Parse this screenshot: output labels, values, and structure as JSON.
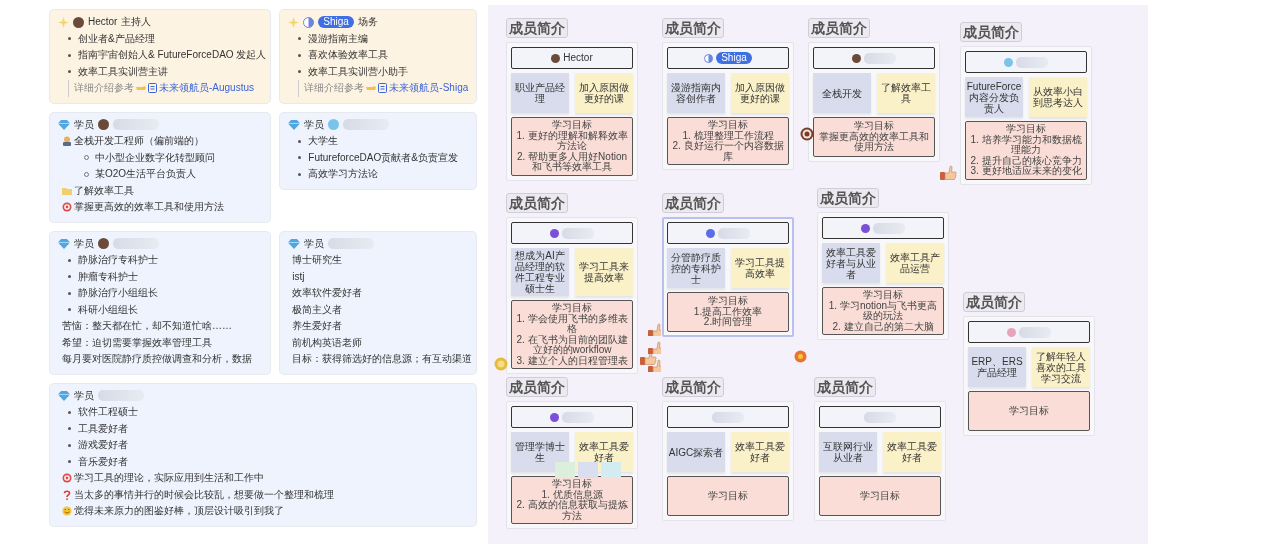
{
  "intro_cards": [
    {
      "kind": "host",
      "name": "Hector",
      "role": "主持人",
      "lines": [
        {
          "kind": "bullet",
          "text": "创业者&产品经理"
        },
        {
          "kind": "bullet",
          "text": "指南宇宙创始人& FutureForceDAO 发起人"
        },
        {
          "kind": "bullet",
          "text": "效率工具实训营主讲"
        },
        {
          "kind": "ref",
          "text": "详细介绍参考",
          "link": "未来领航员-Augustus"
        }
      ]
    },
    {
      "kind": "host",
      "name": "Shiga",
      "role": "场务",
      "lines": [
        {
          "kind": "bullet",
          "text": "漫游指南主编"
        },
        {
          "kind": "bullet",
          "text": "喜欢体验效率工具"
        },
        {
          "kind": "bullet",
          "text": "效率工具实训营小助手"
        },
        {
          "kind": "ref",
          "text": "详细介绍参考",
          "link": "未来领航员-Shiga"
        }
      ]
    },
    {
      "kind": "member",
      "role": "学员",
      "lines": [
        {
          "kind": "person",
          "text": "全栈开发工程师（偏前端的）"
        },
        {
          "kind": "sub",
          "text": "中小型企业数字化转型顾问"
        },
        {
          "kind": "sub",
          "text": "某O2O生活平台负责人"
        },
        {
          "kind": "folder",
          "text": "了解效率工具"
        },
        {
          "kind": "target",
          "text": "掌握更高效的效率工具和使用方法"
        }
      ]
    },
    {
      "kind": "member",
      "role": "学员",
      "lines": [
        {
          "kind": "bullet",
          "text": "大学生"
        },
        {
          "kind": "bullet",
          "text": "FutureforceDAO贡献者&负责宣发"
        },
        {
          "kind": "bullet",
          "text": "高效学习方法论"
        }
      ]
    },
    {
      "kind": "member",
      "role": "学员",
      "lines": [
        {
          "kind": "bullet",
          "text": "静脉治疗专科护士"
        },
        {
          "kind": "bullet",
          "text": "肿瘤专科护士"
        },
        {
          "kind": "bullet",
          "text": "静脉治疗小组组长"
        },
        {
          "kind": "bullet",
          "text": "科研小组组长"
        },
        {
          "kind": "text",
          "text": "苦恼：整天都在忙，却不知道忙啥……"
        },
        {
          "kind": "text",
          "text": "希望：迫切需要掌握效率管理工具"
        },
        {
          "kind": "text",
          "text": "每月要对医院静疗质控做调查和分析，数据"
        }
      ]
    },
    {
      "kind": "member",
      "role": "学员",
      "lines": [
        {
          "kind": "text",
          "text": "博士研究生"
        },
        {
          "kind": "text",
          "text": "istj"
        },
        {
          "kind": "text",
          "text": "效率软件爱好者"
        },
        {
          "kind": "text",
          "text": "极简主义者"
        },
        {
          "kind": "text",
          "text": "养生爱好者"
        },
        {
          "kind": "text",
          "text": "前机构英语老师"
        },
        {
          "kind": "text",
          "text": "目标：获得筛选好的信息源；有互动渠道"
        }
      ]
    },
    {
      "kind": "member",
      "role": "学员",
      "lines": [
        {
          "kind": "bullet",
          "text": "软件工程硕士"
        },
        {
          "kind": "bullet",
          "text": "工具爱好者"
        },
        {
          "kind": "bullet",
          "text": "游戏爱好者"
        },
        {
          "kind": "bullet",
          "text": "音乐爱好者"
        },
        {
          "kind": "target",
          "text": "学习工具的理论，实际应用到生活和工作中"
        },
        {
          "kind": "question",
          "text": "当太多的事情并行的时候会比较乱，想要做一个整理和梳理"
        },
        {
          "kind": "face",
          "text": "觉得未来原力的图鉴好棒，顶层设计吸引到我了"
        }
      ]
    }
  ],
  "whiteboard": {
    "boards": [
      {
        "title": "成员简介",
        "name": "Hector",
        "role": "职业产品经理",
        "reason": "加入原因做更好的课",
        "goals": [
          "学习目标",
          "1. 更好的理解和解释效率方法论",
          "2. 帮助更多人用好Notion和飞书等效率工具"
        ],
        "highlighted": false
      },
      {
        "title": "成员简介",
        "name": "Shiga",
        "role": "漫游指南内容创作者",
        "reason": "加入原因做更好的课",
        "goals": [
          "学习目标",
          "1. 梳理整理工作流程",
          "2. 良好运行一个内容数据库"
        ],
        "highlighted": false
      },
      {
        "title": "成员简介",
        "role": "全栈开发",
        "reason": "了解效率工具",
        "goals": [
          "学习目标",
          "掌握更高效的效率工具和使用方法"
        ],
        "highlighted": false
      },
      {
        "title": "成员简介",
        "role": "FutureForce内容分发负责人",
        "reason": "从效率小白到思考达人",
        "goals": [
          "学习目标",
          "1. 培养学习能力和数据梳理能力",
          "2. 提升自己的核心竞争力",
          "3. 更好地适应未来的变化"
        ],
        "highlighted": false
      },
      {
        "title": "成员简介",
        "role": "想成为AI产品经理的软件工程专业硕士生",
        "reason": "学习工具来提高效率",
        "goals": [
          "学习目标",
          "1. 学会使用飞书的多维表格",
          "2. 在飞书为目前的团队建立好的的workflow",
          "3. 建立个人的日程管理表"
        ],
        "highlighted": false
      },
      {
        "title": "成员简介",
        "role": "分管静疗质控的专科护士",
        "reason": "学习工具提高效率",
        "goals": [
          "学习目标",
          "1.提高工作效率",
          "2.时间管理"
        ],
        "highlighted": true
      },
      {
        "title": "成员简介",
        "role": "效率工具爱好者与从业者",
        "reason": "效率工具产品运营",
        "goals": [
          "学习目标",
          "1. 学习notion与飞书更高级的玩法",
          "2. 建立自己的第二大脑"
        ],
        "highlighted": false
      },
      {
        "title": "成员简介",
        "role": "ERP、ERS产品经理",
        "reason": "了解年轻人喜欢的工具学习交流",
        "goals": [
          "学习目标"
        ],
        "highlighted": false
      },
      {
        "title": "成员简介",
        "role": "管理学博士生",
        "reason": "效率工具爱好者",
        "mini_notes": [
          {
            "color": "#dcefdc"
          },
          {
            "color": "#d9def0"
          },
          {
            "color": "#d3ecef"
          }
        ],
        "goals": [
          "学习目标",
          "1. 优质信息源",
          "2. 高效的信息获取与提炼方法"
        ],
        "highlighted": false
      },
      {
        "title": "成员简介",
        "role": "AIGC探索者",
        "reason": "效率工具爱好者",
        "goals": [
          "学习目标"
        ],
        "highlighted": false
      },
      {
        "title": "成员简介",
        "role": "互联网行业从业者",
        "reason": "效率工具爱好者",
        "goals": [
          "学习目标"
        ],
        "highlighted": false
      }
    ]
  }
}
